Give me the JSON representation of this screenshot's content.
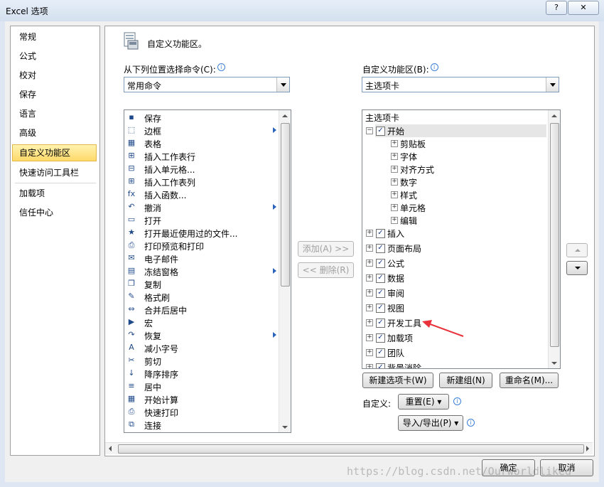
{
  "window": {
    "title": "Excel 选项",
    "help_label": "?",
    "close_label": "✕"
  },
  "nav": {
    "items": [
      "常规",
      "公式",
      "校对",
      "保存",
      "语言",
      "高级",
      "自定义功能区",
      "快速访问工具栏",
      "加载项",
      "信任中心"
    ],
    "selected": "自定义功能区"
  },
  "header": {
    "icon": "customize-ribbon-icon",
    "title": "自定义功能区。"
  },
  "left": {
    "label": "从下列位置选择命令(C):",
    "combo_value": "常用命令",
    "commands": [
      {
        "icon": "save-icon",
        "label": "保存",
        "sub": false
      },
      {
        "icon": "border-icon",
        "label": "边框",
        "sub": true
      },
      {
        "icon": "table-icon",
        "label": "表格",
        "sub": false
      },
      {
        "icon": "insert-row-icon",
        "label": "插入工作表行",
        "sub": false
      },
      {
        "icon": "insert-cell-icon",
        "label": "插入单元格...",
        "sub": false
      },
      {
        "icon": "insert-column-icon",
        "label": "插入工作表列",
        "sub": false
      },
      {
        "icon": "function-icon",
        "label": "插入函数...",
        "sub": false
      },
      {
        "icon": "undo-icon",
        "label": "撤消",
        "sub": true
      },
      {
        "icon": "open-icon",
        "label": "打开",
        "sub": false
      },
      {
        "icon": "recent-file-icon",
        "label": "打开最近使用过的文件...",
        "sub": false
      },
      {
        "icon": "print-preview-icon",
        "label": "打印预览和打印",
        "sub": false
      },
      {
        "icon": "email-icon",
        "label": "电子邮件",
        "sub": false
      },
      {
        "icon": "freeze-panes-icon",
        "label": "冻结窗格",
        "sub": true
      },
      {
        "icon": "copy-icon",
        "label": "复制",
        "sub": false
      },
      {
        "icon": "format-painter-icon",
        "label": "格式刷",
        "sub": false
      },
      {
        "icon": "merge-center-icon",
        "label": "合并后居中",
        "sub": false
      },
      {
        "icon": "macro-icon",
        "label": "宏",
        "sub": false
      },
      {
        "icon": "redo-icon",
        "label": "恢复",
        "sub": true
      },
      {
        "icon": "decrease-font-icon",
        "label": "减小字号",
        "sub": false
      },
      {
        "icon": "cut-icon",
        "label": "剪切",
        "sub": false
      },
      {
        "icon": "sort-descending-icon",
        "label": "降序排序",
        "sub": false
      },
      {
        "icon": "center-icon",
        "label": "居中",
        "sub": false
      },
      {
        "icon": "calculate-icon",
        "label": "开始计算",
        "sub": false
      },
      {
        "icon": "quick-print-icon",
        "label": "快速打印",
        "sub": false
      },
      {
        "icon": "connection-icon",
        "label": "连接",
        "sub": false
      }
    ]
  },
  "middle": {
    "add_label": "添加(A) >>",
    "remove_label": "<< 删除(R)"
  },
  "right": {
    "label": "自定义功能区(B):",
    "combo_value": "主选项卡",
    "tree_header": "主选项卡",
    "tabs": [
      {
        "label": "开始",
        "expanded": true,
        "checked": true,
        "groups": [
          "剪贴板",
          "字体",
          "对齐方式",
          "数字",
          "样式",
          "单元格",
          "编辑"
        ]
      },
      {
        "label": "插入",
        "expanded": false,
        "checked": true
      },
      {
        "label": "页面布局",
        "expanded": false,
        "checked": true
      },
      {
        "label": "公式",
        "expanded": false,
        "checked": true
      },
      {
        "label": "数据",
        "expanded": false,
        "checked": true
      },
      {
        "label": "审阅",
        "expanded": false,
        "checked": true
      },
      {
        "label": "视图",
        "expanded": false,
        "checked": true
      },
      {
        "label": "开发工具",
        "expanded": false,
        "checked": true
      },
      {
        "label": "加载项",
        "expanded": false,
        "checked": true
      },
      {
        "label": "团队",
        "expanded": false,
        "checked": true
      },
      {
        "label": "背景消除",
        "expanded": false,
        "checked": true
      }
    ],
    "new_tab_label": "新建选项卡(W)",
    "new_group_label": "新建组(N)",
    "rename_label": "重命名(M)...",
    "customize_label": "自定义:",
    "reset_label": "重置(E) ▾",
    "import_export_label": "导入/导出(P) ▾"
  },
  "footer": {
    "ok_label": "确定",
    "cancel_label": "取消",
    "watermark": "https://blog.csdn.net/Ourworldliked"
  },
  "colors": {
    "annotation_arrow": "#e8313a",
    "selected_nav": "#ffd96a"
  }
}
